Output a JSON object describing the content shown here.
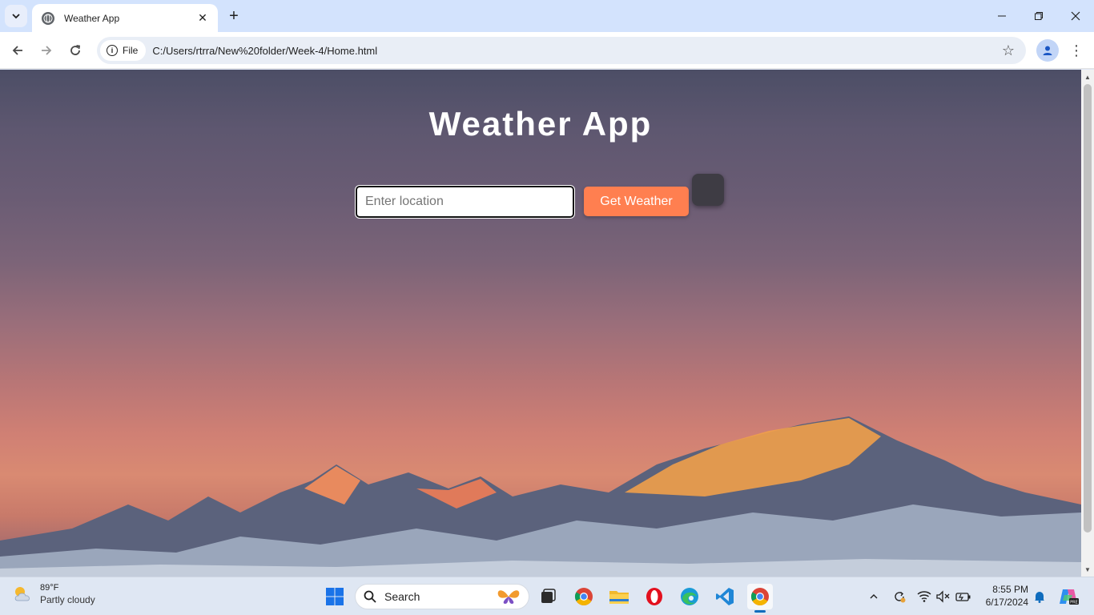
{
  "browser": {
    "tab_title": "Weather App",
    "new_tab_symbol": "+",
    "close_tab_symbol": "✕",
    "site_chip_label": "File",
    "url": "C:/Users/rtrra/New%20folder/Week-4/Home.html"
  },
  "page": {
    "title": "Weather App",
    "location_input": {
      "value": "",
      "placeholder": "Enter location"
    },
    "get_weather_button": "Get Weather"
  },
  "taskbar": {
    "weather_temp": "89°F",
    "weather_condition": "Partly cloudy",
    "search_label": "Search",
    "time": "8:55 PM",
    "date": "6/17/2024"
  },
  "colors": {
    "accent_button": "#ff7f50",
    "tab_strip": "#d3e3fd"
  }
}
